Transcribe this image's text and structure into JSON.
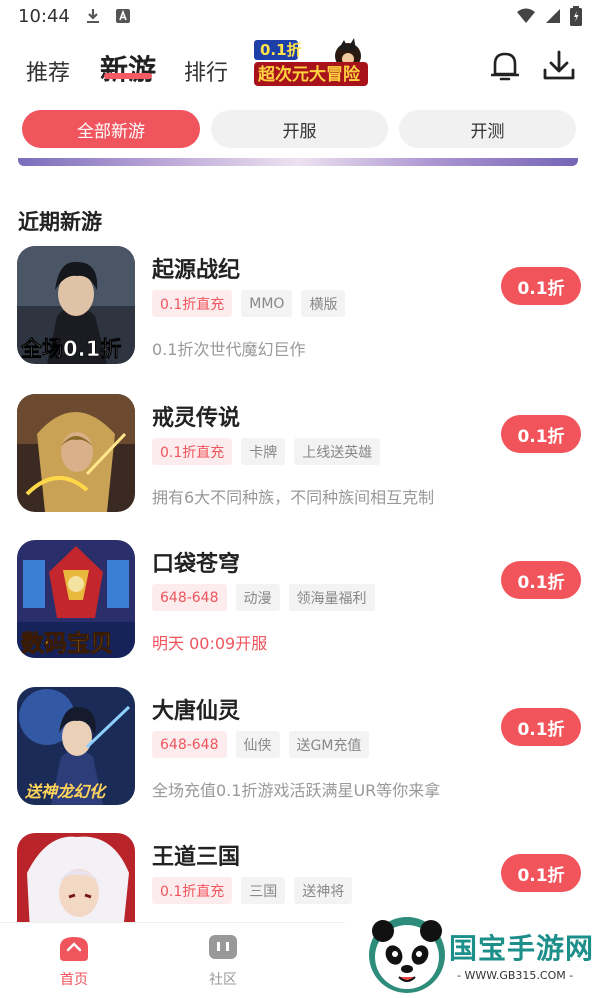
{
  "status_bar": {
    "time": "10:44",
    "left_icons": [
      "download-icon",
      "a-badge-icon"
    ],
    "right_icons": [
      "wifi-icon",
      "signal-icon",
      "battery-icon"
    ]
  },
  "header": {
    "tabs": [
      {
        "label": "推荐",
        "active": false
      },
      {
        "label": "新游",
        "active": true
      },
      {
        "label": "排行",
        "active": false
      }
    ],
    "banner_logo_text_top": "0.1折",
    "banner_logo_text_bottom": "超次元大冒险",
    "icons": [
      "bell-icon",
      "download-icon"
    ]
  },
  "filters": [
    {
      "label": "全部新游",
      "active": true
    },
    {
      "label": "开服",
      "active": false
    },
    {
      "label": "开测",
      "active": false
    }
  ],
  "section_title": "近期新游",
  "games": [
    {
      "title": "起源战纪",
      "tags": [
        {
          "text": "0.1折直充",
          "hot": true
        },
        {
          "text": "MMO",
          "hot": false
        },
        {
          "text": "横版",
          "hot": false
        }
      ],
      "desc": "0.1折次世代魔幻巨作",
      "desc_highlight": false,
      "icon_overlay": "全场0.1折",
      "button": "0.1折"
    },
    {
      "title": "戒灵传说",
      "tags": [
        {
          "text": "0.1折直充",
          "hot": true
        },
        {
          "text": "卡牌",
          "hot": false
        },
        {
          "text": "上线送英雄",
          "hot": false
        }
      ],
      "desc": "拥有6大不同种族，不同种族间相互克制",
      "desc_highlight": false,
      "icon_overlay": "",
      "button": "0.1折"
    },
    {
      "title": "口袋苍穹",
      "tags": [
        {
          "text": "648-648",
          "hot": true
        },
        {
          "text": "动漫",
          "hot": false
        },
        {
          "text": "领海量福利",
          "hot": false
        }
      ],
      "desc": "明天 00:09开服",
      "desc_highlight": true,
      "icon_overlay": "数码宝贝",
      "button": "0.1折"
    },
    {
      "title": "大唐仙灵",
      "tags": [
        {
          "text": "648-648",
          "hot": true
        },
        {
          "text": "仙侠",
          "hot": false
        },
        {
          "text": "送GM充值",
          "hot": false
        }
      ],
      "desc": "全场充值0.1折游戏活跃满星UR等你来拿",
      "desc_highlight": false,
      "icon_overlay": "送神龙幻化",
      "button": "0.1折"
    },
    {
      "title": "王道三国",
      "tags": [
        {
          "text": "0.1折直充",
          "hot": true
        },
        {
          "text": "三国",
          "hot": false
        },
        {
          "text": "送神将",
          "hot": false
        }
      ],
      "desc": "",
      "desc_highlight": false,
      "icon_overlay": "",
      "button": "0.1折"
    }
  ],
  "bottom_nav": [
    {
      "label": "首页",
      "icon": "home-icon",
      "active": true
    },
    {
      "label": "社区",
      "icon": "community-icon",
      "active": false
    }
  ],
  "watermark": {
    "text": "国宝手游网",
    "url": "- WWW.GB315.COM -"
  },
  "colors": {
    "accent": "#f0555d",
    "tag_bg": "#f3f3f3",
    "muted_text": "#999999"
  }
}
